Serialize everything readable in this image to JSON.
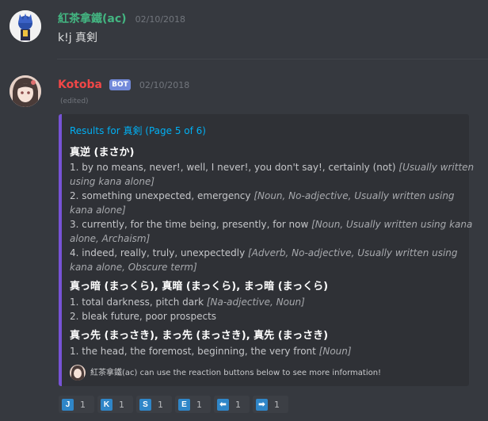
{
  "msg1": {
    "username": "紅茶拿鐵(ac)",
    "username_color": "#43b581",
    "timestamp": "02/10/2018",
    "content": "k!j 真剣"
  },
  "msg2": {
    "username": "Kotoba",
    "username_color": "#f04747",
    "badge": "BOT",
    "timestamp": "02/10/2018",
    "edited": "(edited)"
  },
  "embed": {
    "accent_color": "#7753d6",
    "title": "Results for 真剣 (Page 5 of 6)",
    "entries": [
      {
        "name": "真逆 (まさか)",
        "lines": [
          {
            "text": "1. by no means, never!, well, I never!, you don't say!, certainly (not) ",
            "note": "[Usually written"
          },
          {
            "text": "",
            "note": "using kana alone]"
          },
          {
            "text": "2. something unexpected, emergency ",
            "note": "[Noun, No-adjective, Usually written using"
          },
          {
            "text": "",
            "note": "kana alone]"
          },
          {
            "text": "3. currently, for the time being, presently, for now ",
            "note": "[Noun, Usually written using kana"
          },
          {
            "text": "",
            "note": "alone, Archaism]"
          },
          {
            "text": "4. indeed, really, truly, unexpectedly ",
            "note": "[Adverb, No-adjective, Usually written using"
          },
          {
            "text": "",
            "note": "kana alone, Obscure term]"
          }
        ]
      },
      {
        "name": "真っ暗 (まっくら), 真暗 (まっくら), まっ暗 (まっくら)",
        "lines": [
          {
            "text": "1. total darkness, pitch dark ",
            "note": "[Na-adjective, Noun]"
          },
          {
            "text": "2. bleak future, poor prospects",
            "note": ""
          }
        ]
      },
      {
        "name": "真っ先 (まっさき), まっ先 (まっさき), 真先 (まっさき)",
        "lines": [
          {
            "text": "1. the head, the foremost, beginning, the very front ",
            "note": "[Noun]"
          }
        ]
      }
    ],
    "footer": "紅茶拿鐵(ac) can use the reaction buttons below to see more information!"
  },
  "reactions": [
    {
      "icon": "J",
      "name": "j-key-icon",
      "count": "1"
    },
    {
      "icon": "K",
      "name": "k-key-icon",
      "count": "1"
    },
    {
      "icon": "S",
      "name": "s-key-icon",
      "count": "1"
    },
    {
      "icon": "E",
      "name": "e-key-icon",
      "count": "1"
    },
    {
      "icon": "⬅",
      "name": "left-arrow-icon",
      "count": "1"
    },
    {
      "icon": "➡",
      "name": "right-arrow-icon",
      "count": "1"
    }
  ]
}
